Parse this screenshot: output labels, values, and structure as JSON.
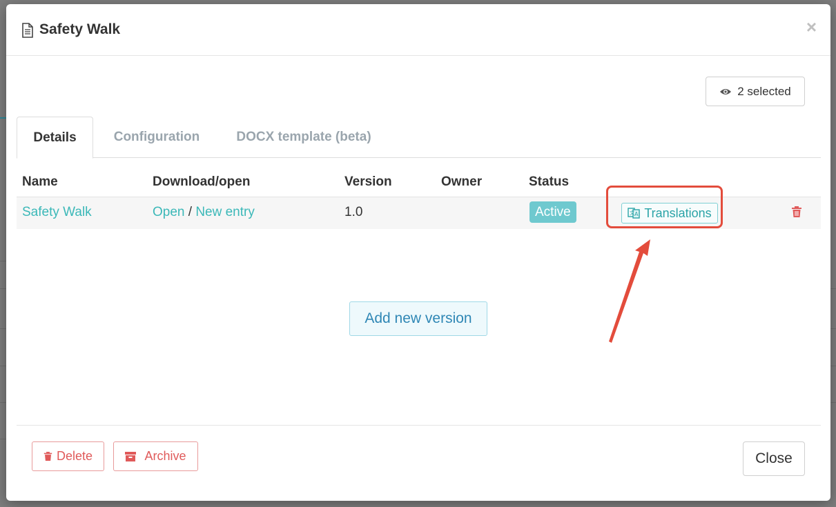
{
  "modal": {
    "title": "Safety Walk",
    "close_icon": "×"
  },
  "selected_button": {
    "label": "2 selected",
    "icon": "eye-icon"
  },
  "tabs": [
    {
      "label": "Details",
      "active": true
    },
    {
      "label": "Configuration",
      "active": false
    },
    {
      "label": "DOCX template (beta)",
      "active": false
    }
  ],
  "table": {
    "headers": [
      "Name",
      "Download/open",
      "Version",
      "Owner",
      "Status"
    ],
    "row": {
      "name": "Safety Walk",
      "open": "Open",
      "separator": "/",
      "new_entry": "New entry",
      "version": "1.0",
      "owner": "",
      "status": "Active",
      "translations": "Translations"
    }
  },
  "add_version_label": "Add new version",
  "footer": {
    "delete_label": "Delete",
    "archive_label": "Archive",
    "close_label": "Close"
  },
  "colors": {
    "accent": "#3bb8b8",
    "status_active": "#6fc9cf",
    "danger": "#e05a5a",
    "highlight": "#e34c3c"
  }
}
